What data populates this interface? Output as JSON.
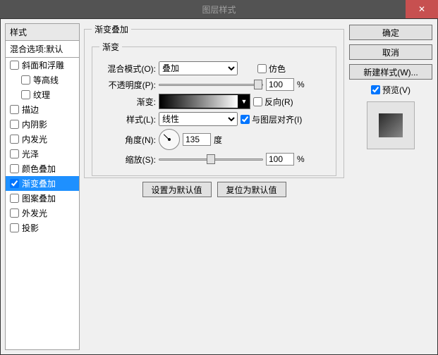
{
  "title": "图层样式",
  "close_glyph": "✕",
  "left": {
    "header": "样式",
    "sub": "混合选项:默认",
    "items": [
      {
        "label": "斜面和浮雕",
        "checked": false,
        "selected": false,
        "indent": false
      },
      {
        "label": "等高线",
        "checked": false,
        "selected": false,
        "indent": true
      },
      {
        "label": "纹理",
        "checked": false,
        "selected": false,
        "indent": true
      },
      {
        "label": "描边",
        "checked": false,
        "selected": false,
        "indent": false
      },
      {
        "label": "内阴影",
        "checked": false,
        "selected": false,
        "indent": false
      },
      {
        "label": "内发光",
        "checked": false,
        "selected": false,
        "indent": false
      },
      {
        "label": "光泽",
        "checked": false,
        "selected": false,
        "indent": false
      },
      {
        "label": "颜色叠加",
        "checked": false,
        "selected": false,
        "indent": false
      },
      {
        "label": "渐变叠加",
        "checked": true,
        "selected": true,
        "indent": false
      },
      {
        "label": "图案叠加",
        "checked": false,
        "selected": false,
        "indent": false
      },
      {
        "label": "外发光",
        "checked": false,
        "selected": false,
        "indent": false
      },
      {
        "label": "投影",
        "checked": false,
        "selected": false,
        "indent": false
      }
    ]
  },
  "main": {
    "outer_legend": "渐变叠加",
    "inner_legend": "渐变",
    "blend_label": "混合模式(O):",
    "blend_value": "叠加",
    "dither_label": "仿色",
    "opacity_label": "不透明度(P):",
    "opacity_value": "100",
    "percent": "%",
    "gradient_label": "渐变:",
    "gradient_arrow": "▼",
    "reverse_label": "反向(R)",
    "style_label": "样式(L):",
    "style_value": "线性",
    "align_label": "与图层对齐(I)",
    "align_checked": true,
    "angle_label": "角度(N):",
    "angle_value": "135",
    "angle_unit": "度",
    "scale_label": "缩放(S):",
    "scale_value": "100",
    "set_default": "设置为默认值",
    "reset_default": "复位为默认值"
  },
  "right": {
    "ok": "确定",
    "cancel": "取消",
    "new_style": "新建样式(W)...",
    "preview_label": "预览(V)",
    "preview_checked": true
  }
}
